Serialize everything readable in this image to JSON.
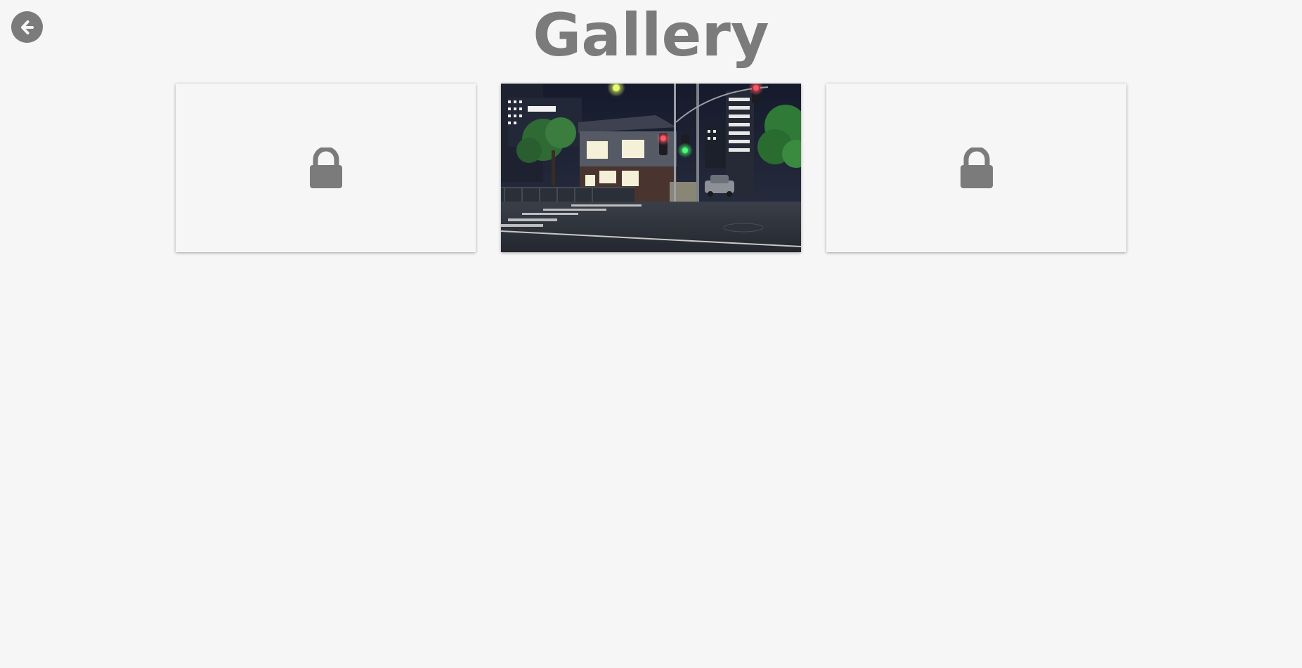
{
  "header": {
    "title": "Gallery",
    "back_icon": "arrow-left-icon"
  },
  "gallery": {
    "items": [
      {
        "state": "locked",
        "icon": "lock-icon"
      },
      {
        "state": "unlocked",
        "description_icon": "night-street-scene"
      },
      {
        "state": "locked",
        "icon": "lock-icon"
      }
    ]
  },
  "colors": {
    "background": "#f6f6f6",
    "accent_gray": "#7b7b7b"
  }
}
